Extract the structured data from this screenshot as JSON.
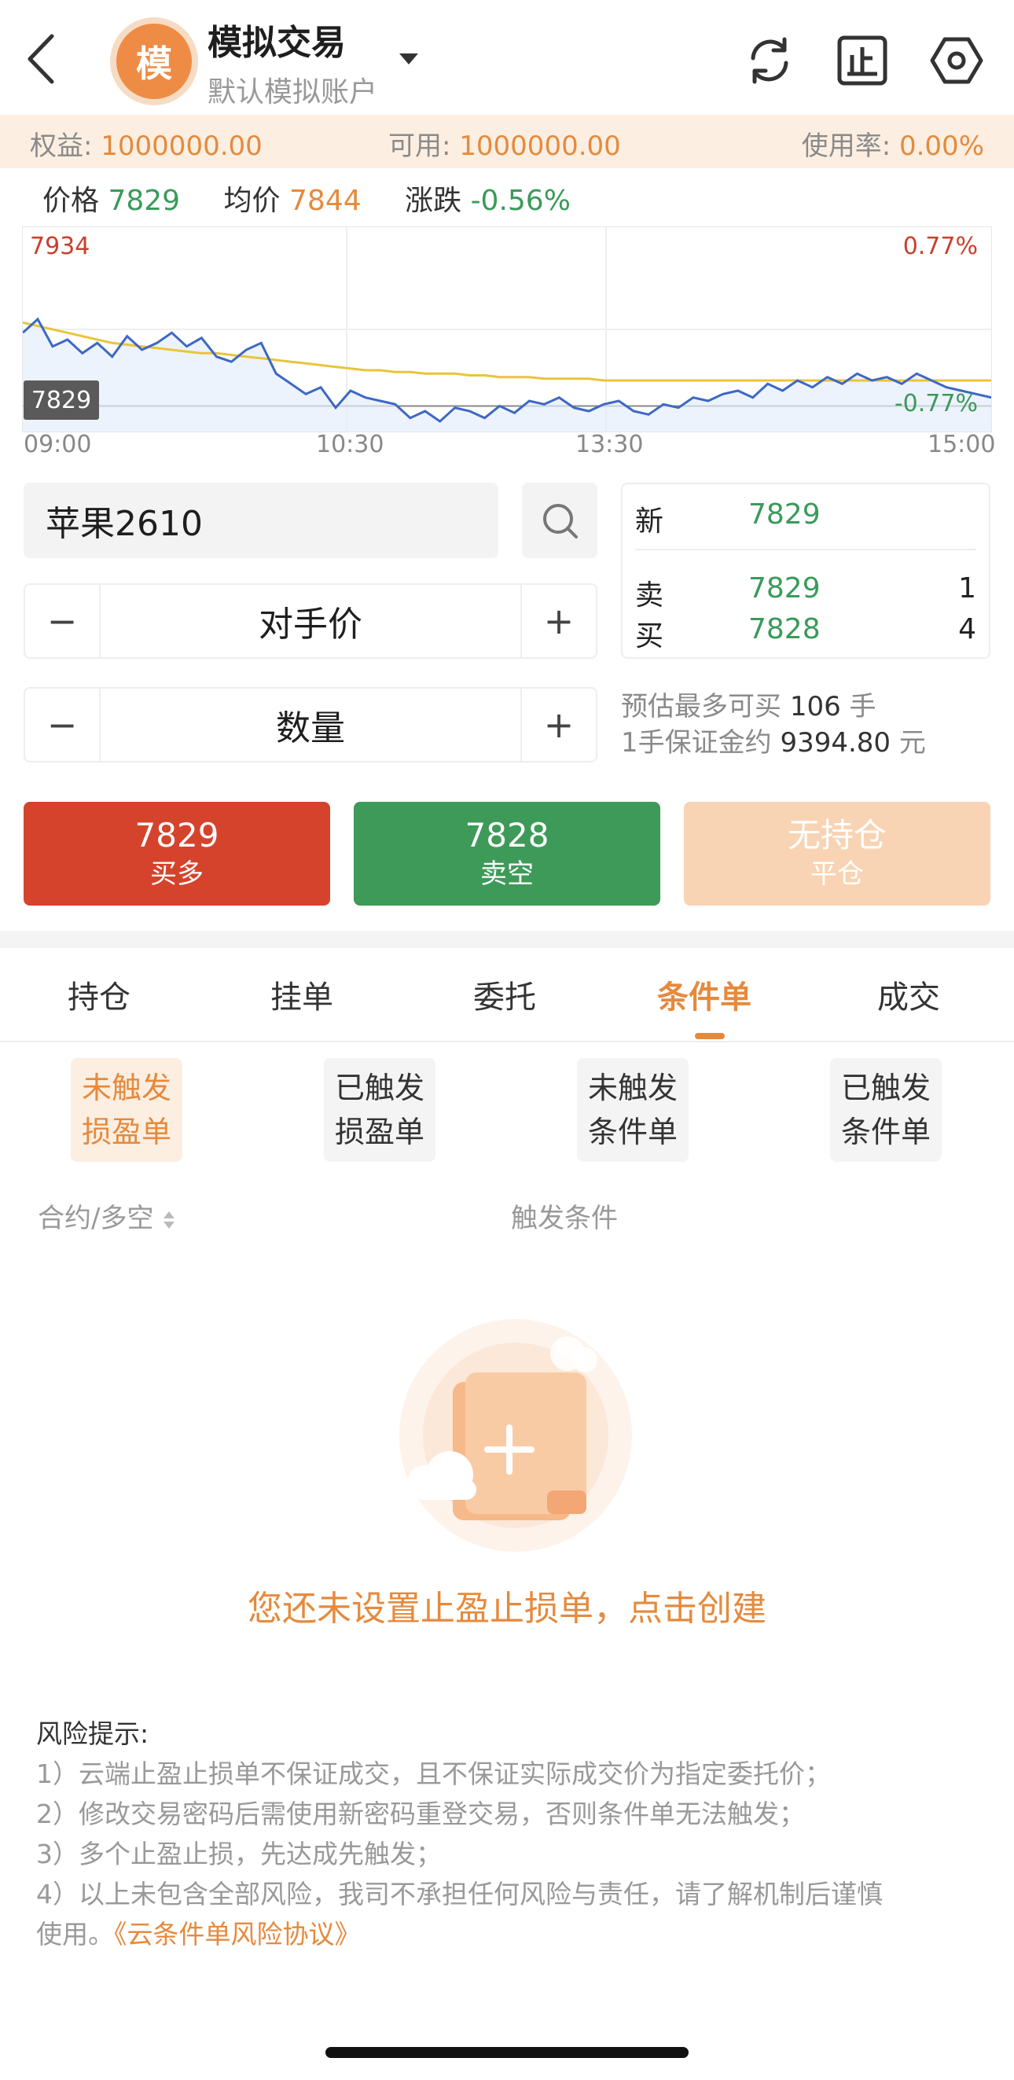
{
  "header": {
    "avatar_char": "模",
    "title": "模拟交易",
    "subtitle": "默认模拟账户"
  },
  "account": {
    "equity_label": "权益:",
    "equity_value": "1000000.00",
    "available_label": "可用:",
    "available_value": "1000000.00",
    "usage_label": "使用率:",
    "usage_value": "0.00%"
  },
  "quote": {
    "price_label": "价格",
    "price_value": "7829",
    "avg_label": "均价",
    "avg_value": "7844",
    "change_label": "涨跌",
    "change_value": "-0.56%"
  },
  "chart_data": {
    "type": "line",
    "y_max_label": "7934",
    "current_label": "7829",
    "pct_top": "0.77%",
    "pct_bottom": "-0.77%",
    "x_ticks": [
      "09:00",
      "10:30",
      "13:30",
      "15:00"
    ],
    "ylim": [
      7814,
      7934
    ],
    "series": [
      {
        "values": [
          7872,
          7880,
          7864,
          7868,
          7860,
          7866,
          7858,
          7870,
          7862,
          7866,
          7872,
          7864,
          7869,
          7858,
          7855,
          7862,
          7866,
          7848,
          7842,
          7836,
          7840,
          7828,
          7838,
          7834,
          7832,
          7830,
          7822,
          7826,
          7820,
          7828,
          7826,
          7822,
          7829,
          7825,
          7832,
          7830,
          7834,
          7828,
          7826,
          7830,
          7832,
          7826,
          7824,
          7830,
          7828,
          7834,
          7832,
          7836,
          7838,
          7834,
          7842,
          7838,
          7844,
          7840,
          7846,
          7842,
          7848,
          7844,
          7846,
          7842,
          7848,
          7844,
          7840,
          7838,
          7836,
          7834
        ]
      },
      {
        "values": [
          7878,
          7876,
          7874,
          7872,
          7870,
          7868,
          7866,
          7865,
          7864,
          7863,
          7862,
          7861,
          7860,
          7860,
          7859,
          7858,
          7857,
          7856,
          7855,
          7854,
          7853,
          7852,
          7851,
          7850,
          7850,
          7849,
          7849,
          7848,
          7848,
          7848,
          7847,
          7847,
          7846,
          7846,
          7846,
          7845,
          7845,
          7845,
          7845,
          7844,
          7844,
          7844,
          7844,
          7844,
          7844,
          7844,
          7844,
          7844,
          7844,
          7844,
          7844,
          7844,
          7844,
          7844,
          7844,
          7844,
          7844,
          7844,
          7844,
          7844,
          7844,
          7844,
          7844,
          7844,
          7844,
          7844
        ]
      }
    ],
    "colors": {
      "price": "#3d68c4",
      "avg": "#e8c53b",
      "up": "#c9402d",
      "down": "#3a9a5a"
    }
  },
  "order": {
    "contract": "苹果2610",
    "price_mode": "对手价",
    "qty_label": "数量",
    "minus": "−",
    "plus": "+"
  },
  "book": {
    "last_label": "新",
    "last_price": "7829",
    "ask_label": "卖",
    "ask_price": "7829",
    "ask_qty": "1",
    "bid_label": "买",
    "bid_price": "7828",
    "bid_qty": "4"
  },
  "estimate": {
    "line1_prefix": "预估最多可买",
    "line1_value": "106",
    "line1_unit": "手",
    "line2_prefix": "1手保证金约",
    "line2_value": "9394.80",
    "line2_unit": "元"
  },
  "actions": {
    "buy_price": "7829",
    "buy_label": "买多",
    "sell_price": "7828",
    "sell_label": "卖空",
    "close_main": "无持仓",
    "close_label": "平仓"
  },
  "tabs": [
    "持仓",
    "挂单",
    "委托",
    "条件单",
    "成交"
  ],
  "filters": [
    {
      "l1": "未触发",
      "l2": "损盈单"
    },
    {
      "l1": "已触发",
      "l2": "损盈单"
    },
    {
      "l1": "未触发",
      "l2": "条件单"
    },
    {
      "l1": "已触发",
      "l2": "条件单"
    }
  ],
  "columns": {
    "contract": "合约/多空",
    "trigger": "触发条件"
  },
  "empty": {
    "text": "您还未设置止盈止损单，点击创建"
  },
  "risk": {
    "title": "风险提示:",
    "item1": "1）云端止盈止损单不保证成交，且不保证实际成交价为指定委托价；",
    "item2": "2）修改交易密码后需使用新密码重登交易，否则条件单无法触发；",
    "item3": "3）多个止盈止损，先达成先触发；",
    "item4a": "4）以上未包含全部风险，我司不承担任何风险与责任，请了解机制后谨慎",
    "item4b": "使用。",
    "link": "《云条件单风险协议》"
  }
}
